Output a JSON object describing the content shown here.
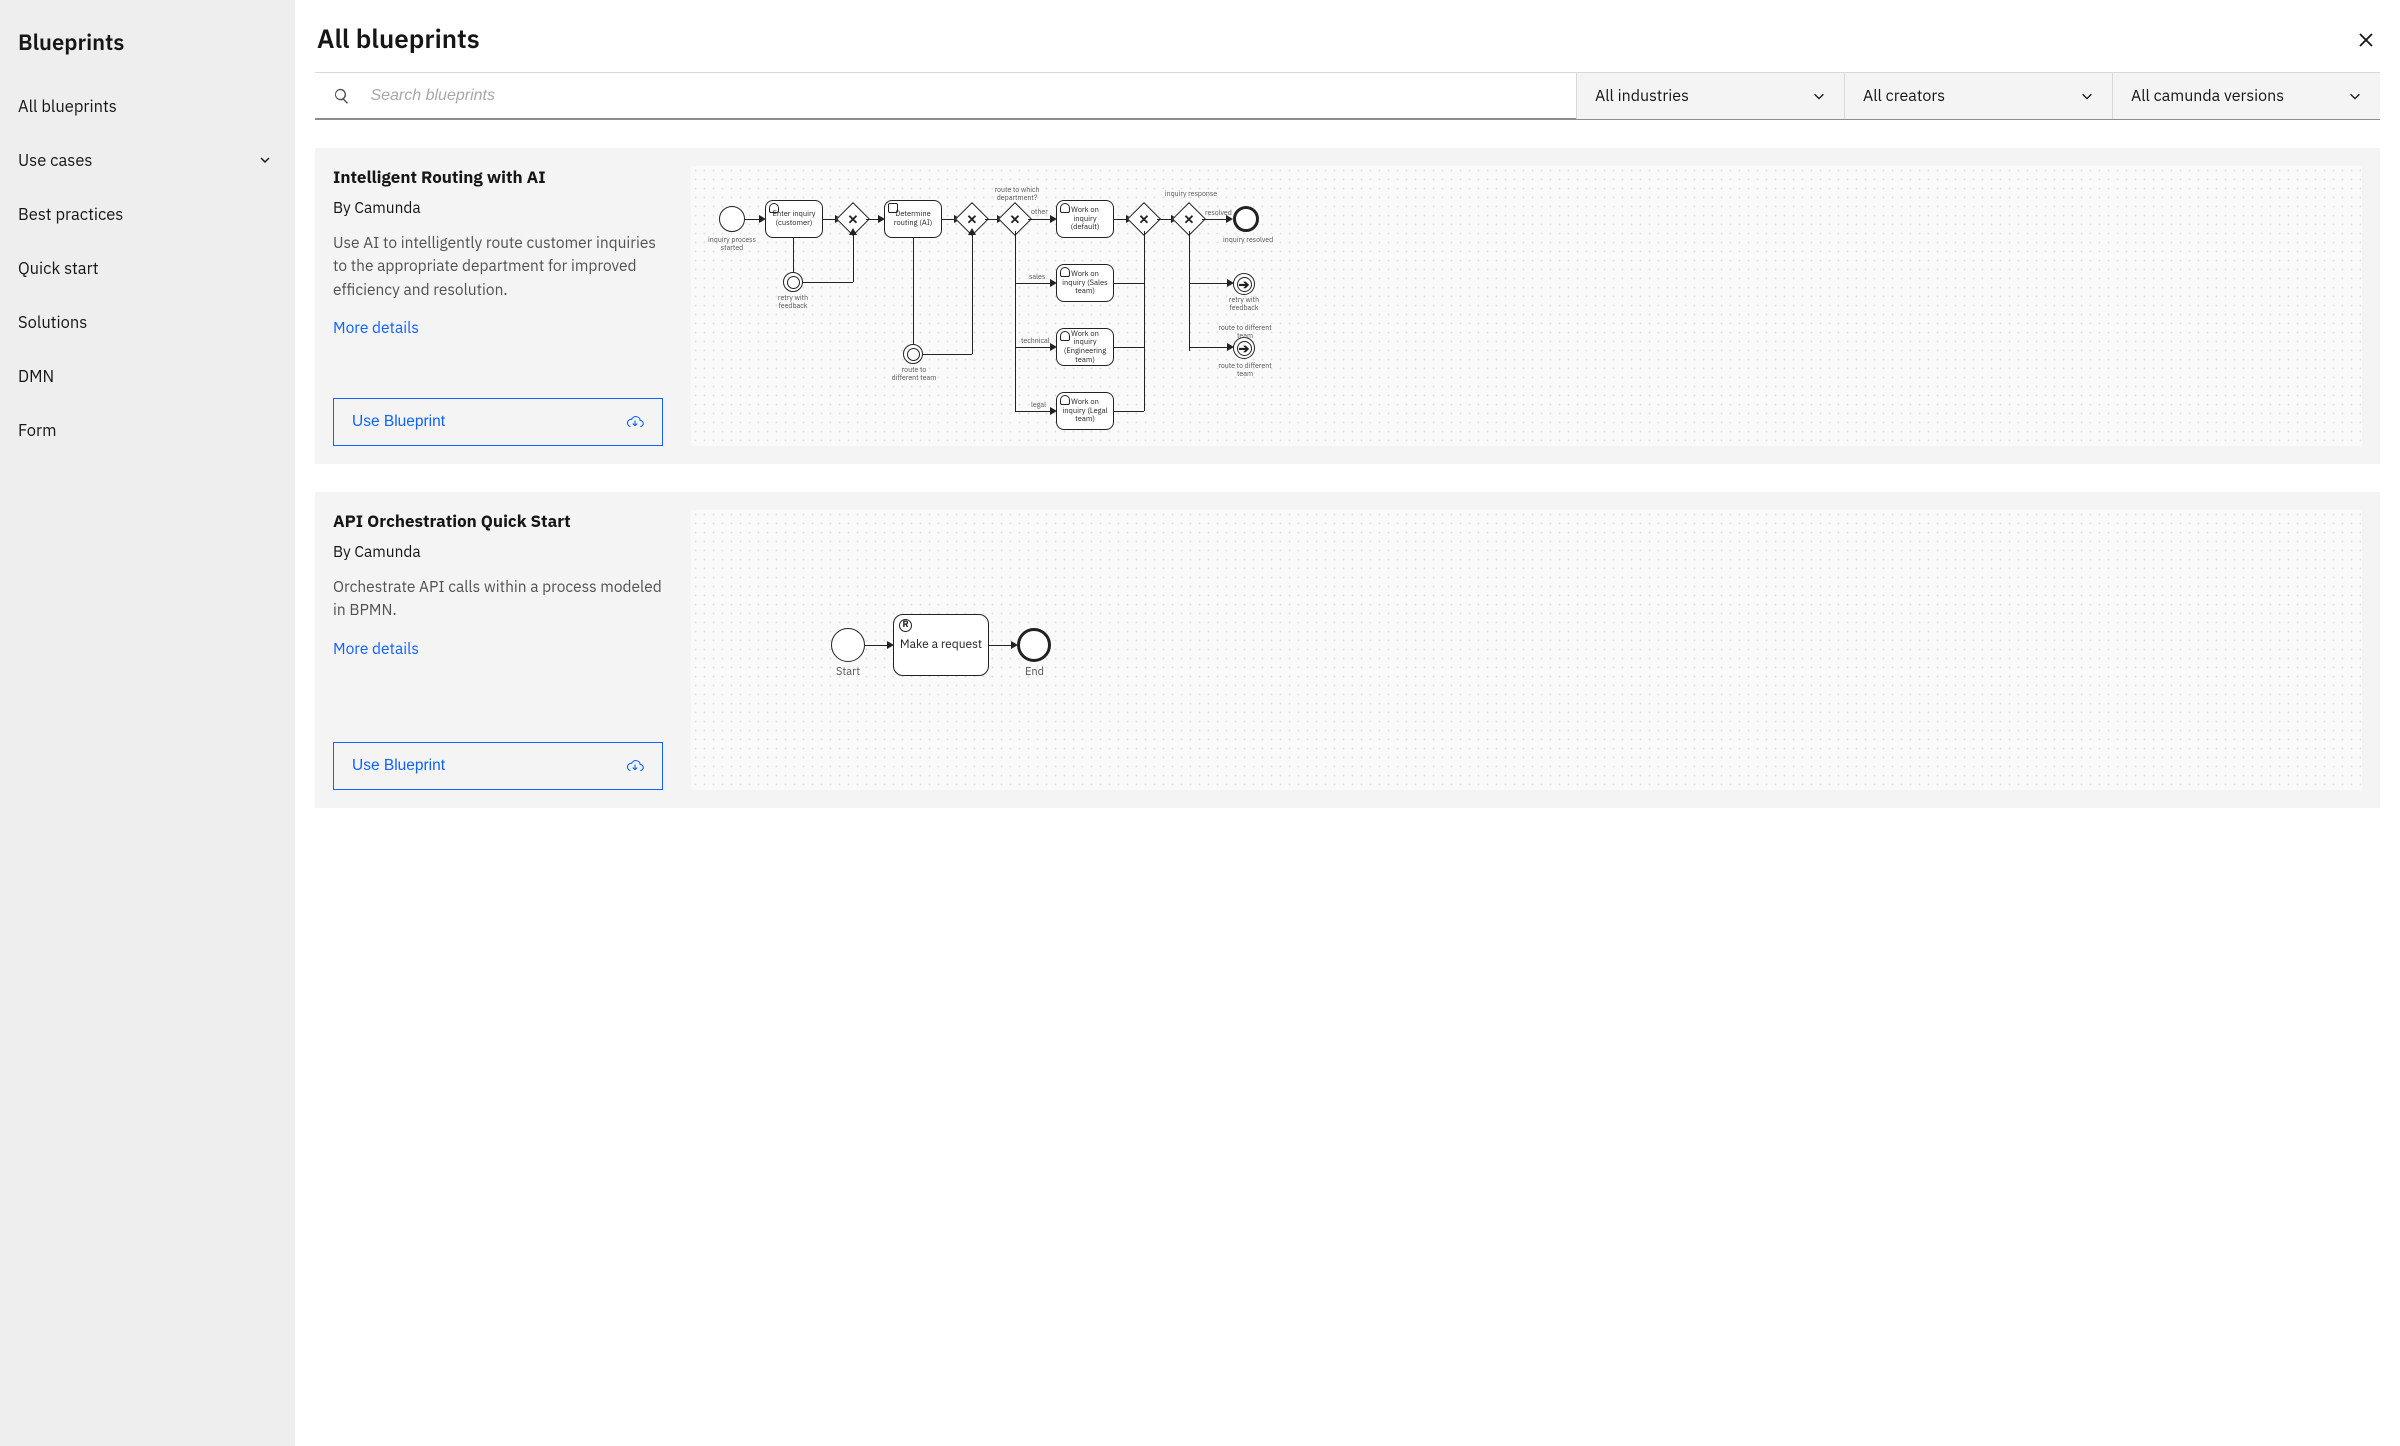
{
  "sidebar": {
    "title": "Blueprints",
    "items": [
      {
        "label": "All blueprints"
      },
      {
        "label": "Use cases",
        "expandable": true
      },
      {
        "label": "Best practices"
      },
      {
        "label": "Quick start"
      },
      {
        "label": "Solutions"
      },
      {
        "label": "DMN"
      },
      {
        "label": "Form"
      }
    ]
  },
  "header": {
    "title": "All blueprints"
  },
  "filters": {
    "search_placeholder": "Search blueprints",
    "industries": "All industries",
    "creators": "All creators",
    "versions": "All camunda versions"
  },
  "common": {
    "more_details": "More details",
    "use_blueprint": "Use Blueprint"
  },
  "cards": [
    {
      "title": "Intelligent Routing with AI",
      "author": "By Camunda",
      "description": "Use AI to intelligently route customer inquiries to the appropriate department for improved efficiency and resolution.",
      "diagram": {
        "start_label": "inquiry process started",
        "task_enter": "Enter inquiry (customer)",
        "task_determine": "Determine routing (AI)",
        "gw_department": "route to which department?",
        "task_default": "Work on inquiry (default)",
        "task_sales": "Work on inquiry (Sales team)",
        "task_eng": "Work on inquiry (Engineering team)",
        "task_legal": "Work on inquiry (Legal team)",
        "gw_response": "inquiry response",
        "resolved_label": "resolved",
        "end_label": "inquiry resolved",
        "retry_label": "retry with feedback",
        "route_diff_label": "route to different team",
        "branch_other": "other",
        "branch_sales": "sales",
        "branch_technical": "technical",
        "branch_legal": "legal"
      }
    },
    {
      "title": "API Orchestration Quick Start",
      "author": "By Camunda",
      "description": "Orchestrate API calls within a process modeled in BPMN.",
      "diagram": {
        "start_label": "Start",
        "task_request": "Make a request",
        "end_label": "End"
      }
    }
  ]
}
